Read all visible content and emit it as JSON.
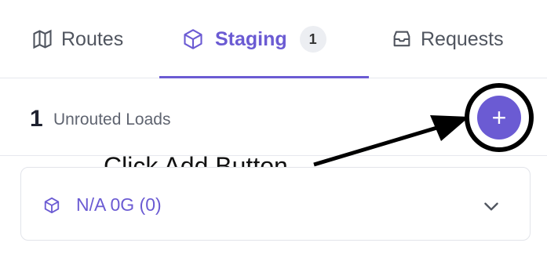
{
  "tabs": {
    "routes": {
      "label": "Routes",
      "icon": "map-icon"
    },
    "staging": {
      "label": "Staging",
      "count": "1",
      "icon": "package-icon"
    },
    "requests": {
      "label": "Requests",
      "icon": "inbox-icon"
    }
  },
  "loads": {
    "count": "1",
    "label": "Unrouted Loads"
  },
  "add_button": {
    "label": "+",
    "icon": "plus-icon"
  },
  "annotation": {
    "text": "Click Add Button"
  },
  "card": {
    "label": "N/A 0G (0)",
    "icon": "package-icon",
    "toggle_icon": "chevron-down-icon"
  },
  "colors": {
    "accent": "#6b5bd3",
    "text": "#1f2230",
    "muted": "#5f6470"
  }
}
